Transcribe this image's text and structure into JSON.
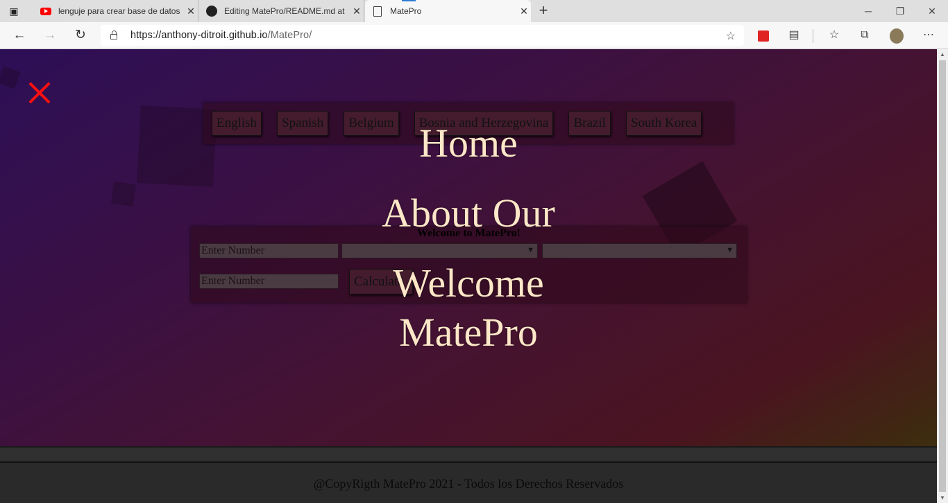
{
  "browser": {
    "tabs": [
      {
        "title": "lenguje para crear base de datos",
        "favicon": "youtube-icon",
        "active": false
      },
      {
        "title": "Editing MatePro/README.md at",
        "favicon": "github-icon",
        "active": false
      },
      {
        "title": "MatePro",
        "favicon": "page-icon",
        "active": true
      }
    ],
    "url_host": "https://anthony-ditroit.github.io",
    "url_path": "/MatePro/"
  },
  "page": {
    "languages": [
      "English",
      "Spanish",
      "Belgium",
      "Bosnia and Herzegovina",
      "Brazil",
      "South Korea"
    ],
    "calculator": {
      "title": "Welcome to MatePro!",
      "input1_placeholder": "Enter Number",
      "input2_placeholder": "Enter Number",
      "select1_value": "",
      "select2_value": "",
      "button_label": "Calculate"
    },
    "overlay_menu": [
      "Home",
      "About Our",
      "Welcome",
      "MatePro"
    ],
    "footer": "@CopyRigth MatePro 2021 - Todos los Derechos Reservados"
  },
  "colors": {
    "close_icon": "#ff1010",
    "overlay_text": "#fde7c8",
    "tab_indicator": "#2e7bd6"
  }
}
